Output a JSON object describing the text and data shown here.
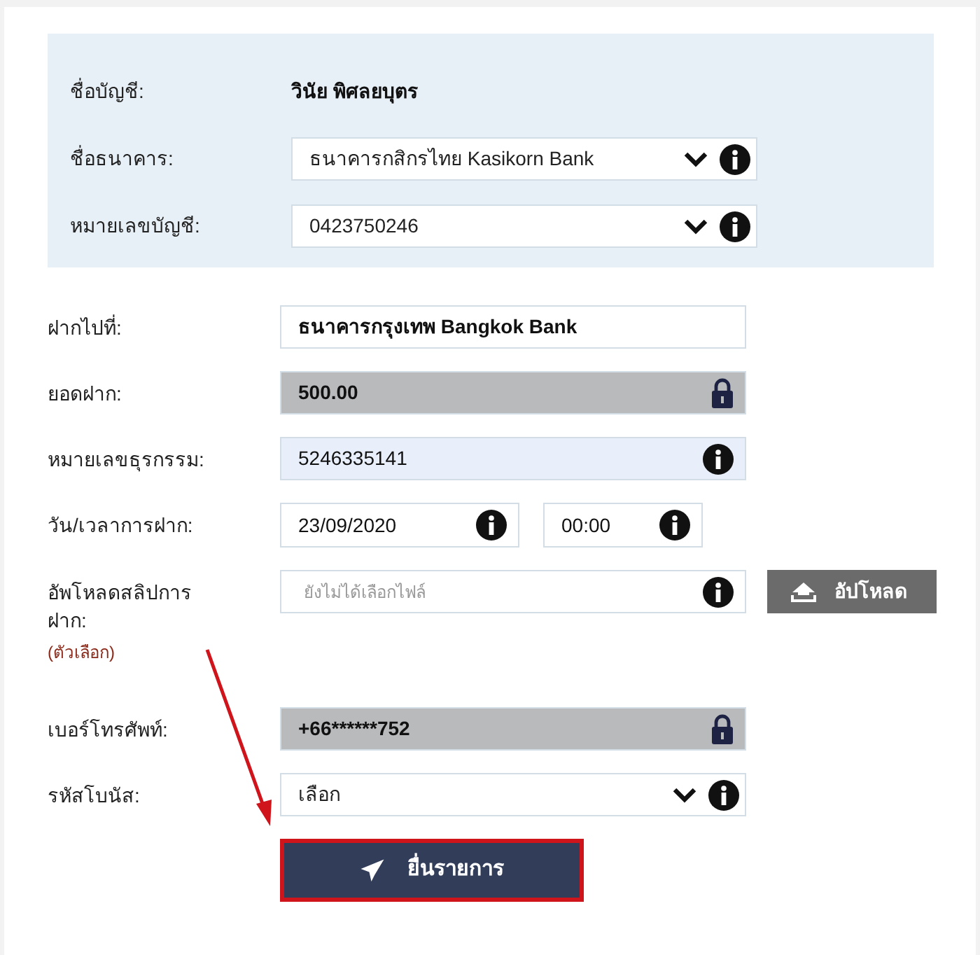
{
  "account_box": {
    "rows": [
      {
        "kind": "text",
        "label": "ชื่อบัญชี:",
        "value": "วินัย พิศลยบุตร"
      },
      {
        "kind": "select",
        "label": "ชื่อธนาคาร:",
        "value": "ธนาคารกสิกรไทย Kasikorn Bank"
      },
      {
        "kind": "select",
        "label": "หมายเลขบัญชี:",
        "value": "0423750246"
      }
    ]
  },
  "form": {
    "rows": [
      {
        "kind": "bold",
        "label": "ฝากไปที่:",
        "value": "ธนาคารกรุงเทพ Bangkok Bank"
      },
      {
        "kind": "locked",
        "label": "ยอดฝาก:",
        "value": "500.00"
      },
      {
        "kind": "input",
        "label": "หมายเลขธุรกรรม:",
        "value": "5246335141",
        "focused": true
      },
      {
        "kind": "datetime",
        "label": "วัน/เวลาการฝาก:",
        "value": "23/09/2020",
        "time": "00:00"
      },
      {
        "kind": "upload",
        "label": "อัพโหลดสลิปการฝาก:",
        "note": "(ตัวเลือก)",
        "placeholder": "ยังไม่ได้เลือกไฟล์",
        "button": "อัปโหลด"
      },
      {
        "kind": "locked",
        "label": "เบอร์โทรศัพท์:",
        "value": "+66******752"
      },
      {
        "kind": "select",
        "label": "รหัสโบนัส:",
        "value": "เลือก"
      }
    ],
    "submit": {
      "label": "ยื่นรายการ",
      "highlighted": true
    }
  }
}
